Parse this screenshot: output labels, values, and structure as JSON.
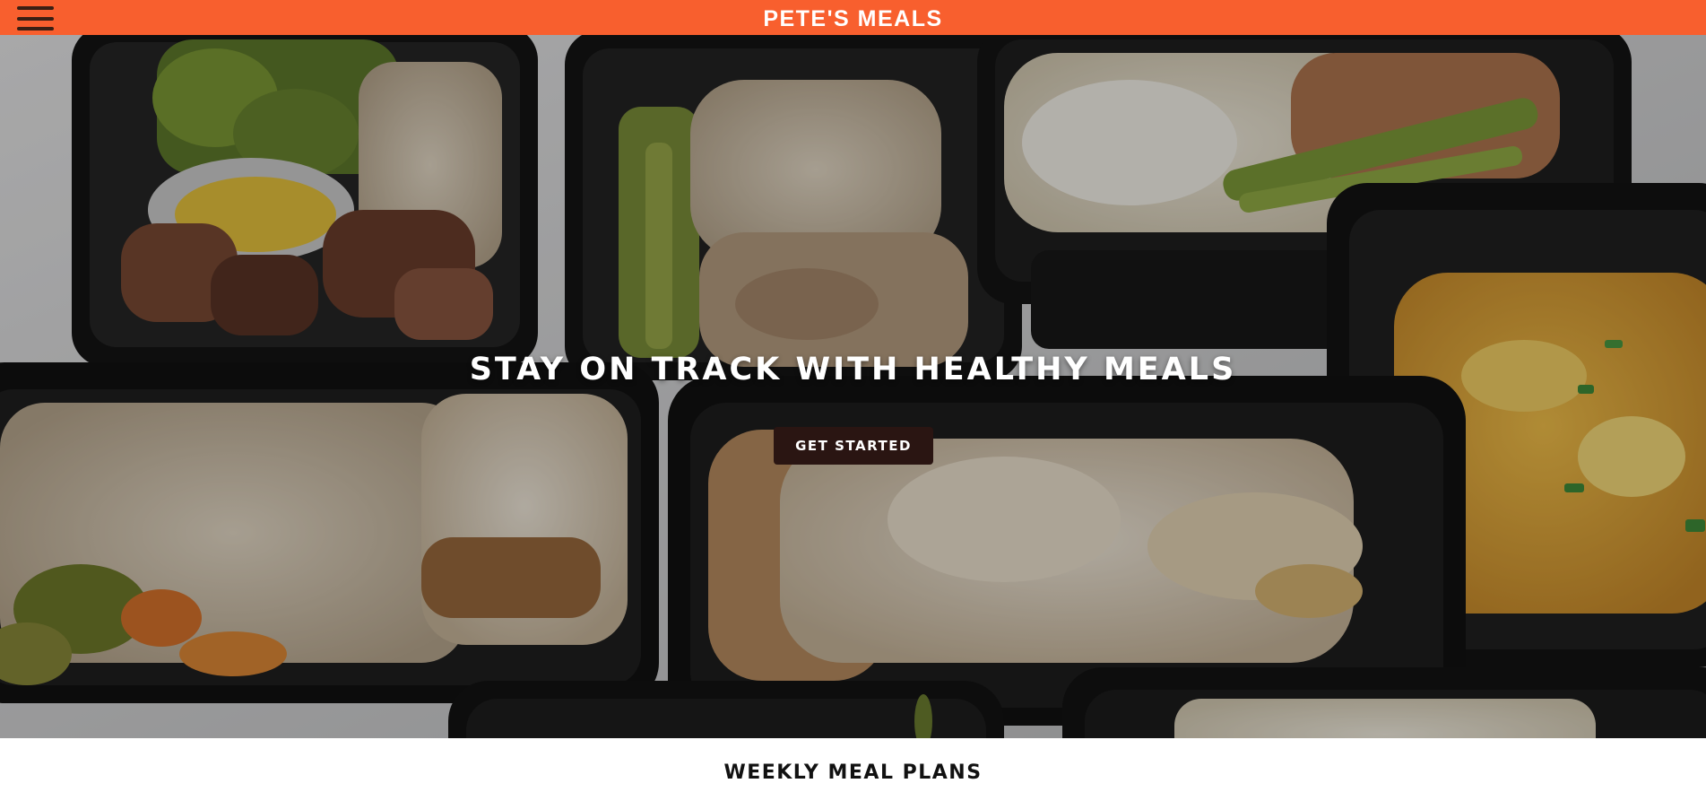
{
  "header": {
    "brand": "PETE'S MEALS",
    "menu_icon": "hamburger-menu-icon",
    "background_color": "#f85f2e"
  },
  "hero": {
    "headline": "STAY ON TRACK WITH HEALTHY MEALS",
    "cta_label": "GET STARTED",
    "image_subject": "meal-prep-containers-photo"
  },
  "section": {
    "title": "WEEKLY MEAL PLANS"
  }
}
